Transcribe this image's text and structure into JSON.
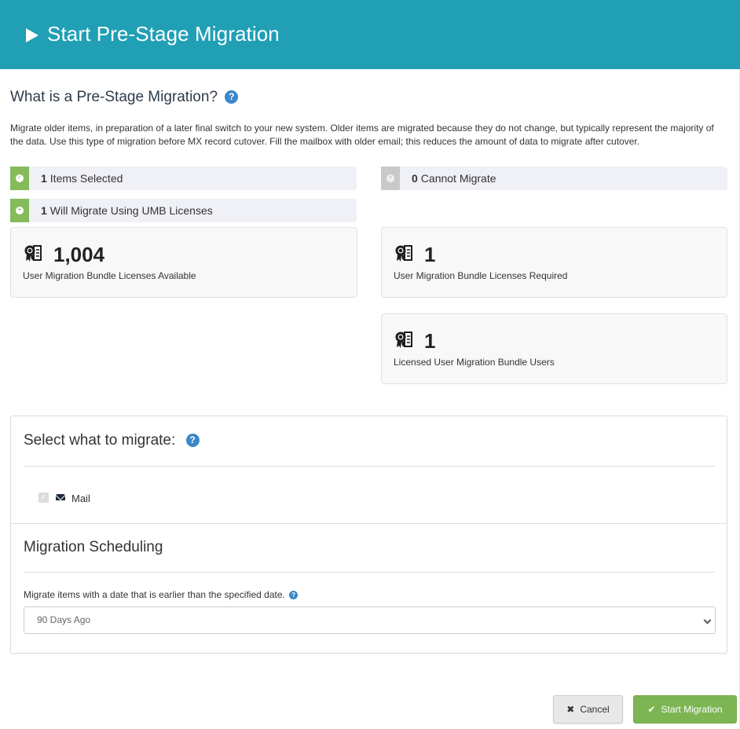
{
  "header": {
    "icon": "play-icon",
    "title": "Start Pre-Stage Migration",
    "background_color": "#209fb5"
  },
  "intro": {
    "title": "What is a Pre-Stage Migration?",
    "help_icon": "question-circle-icon",
    "description": "Migrate older items, in preparation of a later final switch to your new system. Older items are migrated because they do not change, but typically represent the majority of the data. Use this type of migration before MX record cutover. Fill the mailbox with older email; this reduces the amount of data to migrate after cutover."
  },
  "status": {
    "items_selected": {
      "count": "1",
      "label": "Items Selected",
      "icon": "check-circle-icon",
      "color": "#86bb5c"
    },
    "will_migrate": {
      "count": "1",
      "label": "Will Migrate Using UMB Licenses",
      "icon": "plus-circle-icon",
      "color": "#86bb5c"
    },
    "cannot_migrate": {
      "count": "0",
      "label": "Cannot Migrate",
      "icon": "x-circle-icon",
      "color": "#c9c9c9"
    }
  },
  "licenses": {
    "available": {
      "value": "1,004",
      "label": "User Migration Bundle Licenses Available",
      "icon": "certificate-icon"
    },
    "required": {
      "value": "1",
      "label": "User Migration Bundle Licenses Required",
      "icon": "certificate-icon"
    },
    "licensed_users": {
      "value": "1",
      "label": "Licensed User Migration Bundle Users",
      "icon": "certificate-icon"
    }
  },
  "select_section": {
    "title": "Select what to migrate:",
    "help_icon": "question-circle-icon",
    "items": [
      {
        "label": "Mail",
        "icon": "envelope-icon",
        "checked": true,
        "disabled": true
      }
    ]
  },
  "scheduling": {
    "title": "Migration Scheduling",
    "field_label": "Migrate items with a date that is earlier than the specified date.",
    "help_icon": "question-circle-icon",
    "selected_value": "90 Days Ago"
  },
  "buttons": {
    "cancel": {
      "label": "Cancel",
      "icon": "times-icon"
    },
    "start": {
      "label": "Start Migration",
      "icon": "check-icon",
      "color": "#7cb552"
    }
  }
}
